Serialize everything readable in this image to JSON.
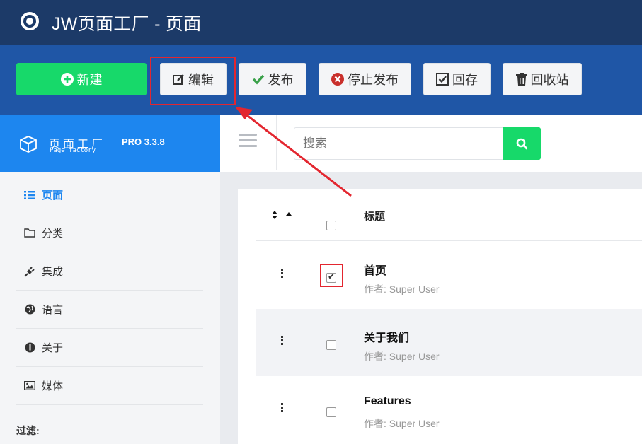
{
  "app": {
    "title": "JW页面工厂 - 页面"
  },
  "toolbar": {
    "new_label": "新建",
    "edit_label": "编辑",
    "publish_label": "发布",
    "unpublish_label": "停止发布",
    "archive_label": "回存",
    "trash_label": "回收站"
  },
  "brand": {
    "name": "页面工厂",
    "sub": "Page factory",
    "version": "PRO 3.3.8"
  },
  "search": {
    "placeholder": "搜索"
  },
  "sidebar": {
    "items": [
      {
        "label": "页面",
        "icon": "list-icon",
        "active": true
      },
      {
        "label": "分类",
        "icon": "folder-icon"
      },
      {
        "label": "集成",
        "icon": "plug-icon"
      },
      {
        "label": "语言",
        "icon": "globe-icon"
      },
      {
        "label": "关于",
        "icon": "info-icon"
      },
      {
        "label": "媒体",
        "icon": "image-icon"
      }
    ],
    "filter_label": "过滤:"
  },
  "table": {
    "header_title": "标题",
    "rows": [
      {
        "title": "首页",
        "author": "作者: Super User",
        "checked": true
      },
      {
        "title": "关于我们",
        "author": "作者: Super User",
        "checked": false
      },
      {
        "title": "Features",
        "author": "作者: Super User",
        "checked": false
      }
    ]
  },
  "colors": {
    "titlebar": "#1c3a68",
    "toolbar": "#1f56a6",
    "brand": "#1d86ef",
    "accent_green": "#17d96a",
    "highlight_red": "#e3262f"
  }
}
